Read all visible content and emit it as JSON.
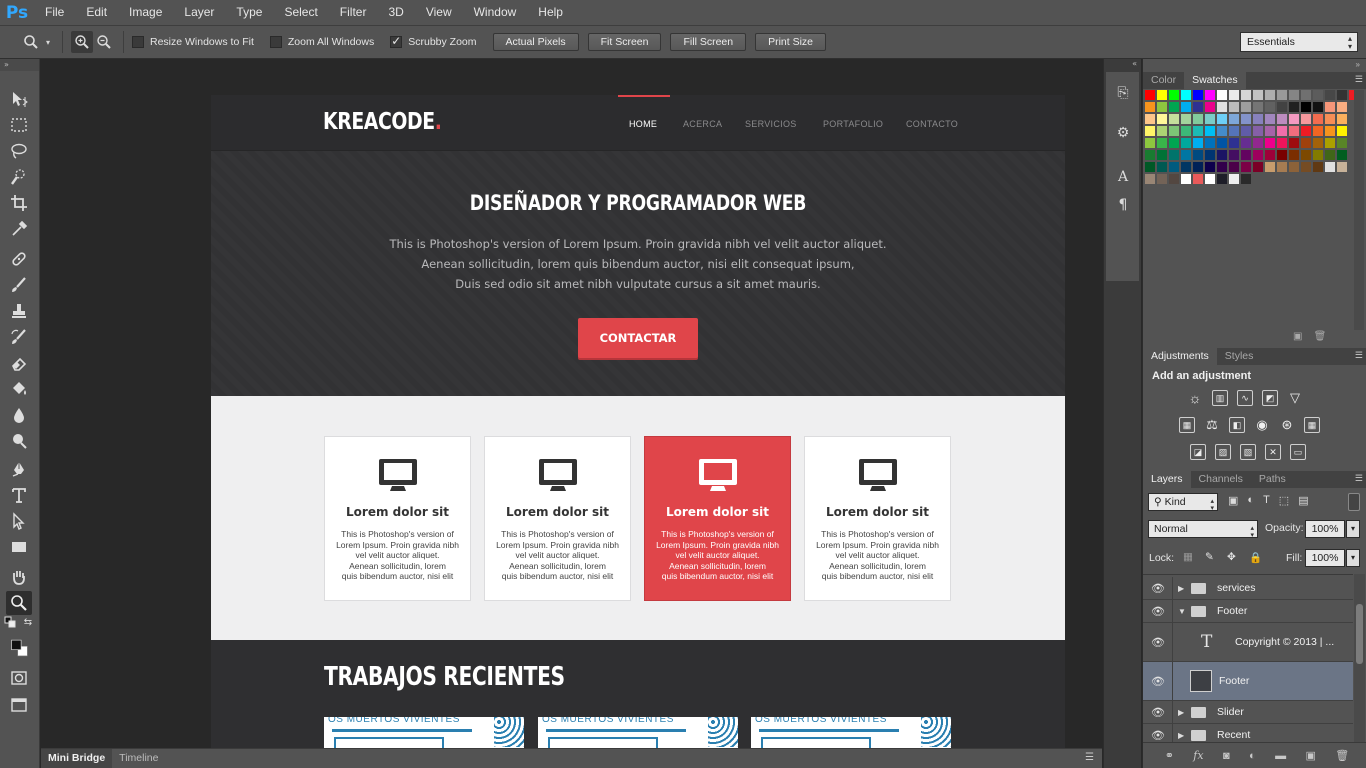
{
  "app": {
    "logo": "Ps"
  },
  "menu": [
    "File",
    "Edit",
    "Image",
    "Layer",
    "Type",
    "Select",
    "Filter",
    "3D",
    "View",
    "Window",
    "Help"
  ],
  "options": {
    "resize_windows": "Resize Windows to Fit",
    "zoom_all": "Zoom All Windows",
    "scrubby_zoom": "Scrubby Zoom",
    "buttons": [
      "Actual Pixels",
      "Fit Screen",
      "Fill Screen",
      "Print Size"
    ],
    "workspace": "Essentials"
  },
  "site": {
    "logo": "KREACODE",
    "logo_dot": ".",
    "nav": [
      "HOME",
      "ACERCA",
      "SERVICIOS",
      "PORTAFOLIO",
      "CONTACTO"
    ],
    "hero_title": "DISEÑADOR Y PROGRAMADOR WEB",
    "hero_lines": [
      "This is Photoshop's version  of Lorem Ipsum. Proin gravida nibh vel velit auctor aliquet.",
      "Aenean sollicitudin, lorem quis bibendum auctor, nisi elit consequat ipsum,",
      "Duis sed odio sit amet nibh vulputate cursus a sit amet mauris."
    ],
    "hero_button": "CONTACTAR",
    "cards": [
      {
        "title": "Lorem dolor sit",
        "text": [
          "This is Photoshop's version  of",
          "Lorem Ipsum. Proin gravida nibh",
          "vel velit auctor aliquet.",
          "Aenean sollicitudin, lorem",
          "quis  bibendum auctor, nisi elit"
        ]
      },
      {
        "title": "Lorem dolor sit",
        "text": [
          "This is Photoshop's version  of",
          "Lorem Ipsum. Proin gravida nibh",
          "vel velit auctor aliquet.",
          "Aenean sollicitudin, lorem",
          "quis  bibendum auctor, nisi elit"
        ]
      },
      {
        "title": "Lorem dolor sit",
        "text": [
          "This is Photoshop's version  of",
          "Lorem Ipsum. Proin gravida nibh",
          "vel velit auctor aliquet.",
          "Aenean sollicitudin, lorem",
          "quis  bibendum auctor, nisi elit"
        ]
      },
      {
        "title": "Lorem dolor sit",
        "text": [
          "This is Photoshop's version  of",
          "Lorem Ipsum. Proin gravida nibh",
          "vel velit auctor aliquet.",
          "Aenean sollicitudin, lorem",
          "quis  bibendum auctor, nisi elit"
        ]
      }
    ],
    "recent_title": "TRABAJOS RECIENTES",
    "thumb_caption": "OS MUERTOS VIVIENTES"
  },
  "bottom_tabs": [
    "Mini Bridge",
    "Timeline"
  ],
  "panels": {
    "color_tabs": [
      "Color",
      "Swatches"
    ],
    "adj_tabs": [
      "Adjustments",
      "Styles"
    ],
    "adj_title": "Add an adjustment",
    "layers_tabs": [
      "Layers",
      "Channels",
      "Paths"
    ],
    "filter": "Kind",
    "blend_mode": "Normal",
    "opacity_label": "Opacity:",
    "opacity": "100%",
    "lock_label": "Lock:",
    "fill_label": "Fill:",
    "fill": "100%",
    "layers": [
      {
        "name": "services",
        "kind": "group",
        "expanded": false
      },
      {
        "name": "Footer",
        "kind": "group",
        "expanded": true
      },
      {
        "name": "Copyright © 2013 | ...",
        "kind": "text"
      },
      {
        "name": "Footer",
        "kind": "shape",
        "selected": true
      },
      {
        "name": "Slider",
        "kind": "group",
        "expanded": false
      },
      {
        "name": "Recent",
        "kind": "group",
        "expanded": false
      }
    ]
  },
  "colors": {
    "accent_red": "#e0454a",
    "ui_gray": "#535353",
    "canvas_bg": "#282828",
    "selected_layer": "#6b7586",
    "ps_blue": "#31a8ff"
  }
}
